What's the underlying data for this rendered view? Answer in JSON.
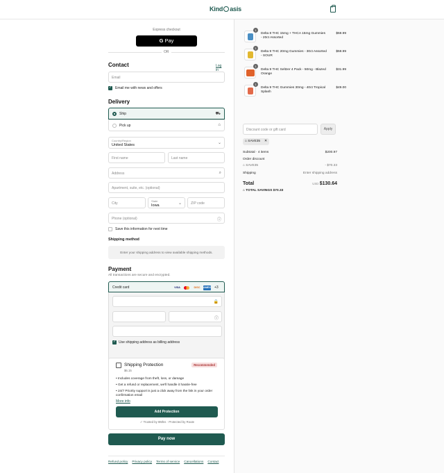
{
  "header": {
    "brand_part1": "Kind",
    "brand_part2": "asis"
  },
  "express": {
    "label": "Express checkout",
    "gpay": "Pay",
    "or": "OR"
  },
  "contact": {
    "title": "Contact",
    "login": "Log in",
    "email_placeholder": "Email",
    "newsletter_label": "Email me with news and offers",
    "newsletter_checked": true
  },
  "delivery": {
    "title": "Delivery",
    "options": [
      {
        "label": "Ship",
        "selected": true
      },
      {
        "label": "Pick up",
        "selected": false
      }
    ],
    "country_label": "Country/Region",
    "country_value": "United States",
    "first_name": "First name",
    "last_name": "Last name",
    "address": "Address",
    "apartment": "Apartment, suite, etc. (optional)",
    "city": "City",
    "state_label": "State",
    "state_value": "Iowa",
    "zip": "ZIP code",
    "phone": "Phone (optional)",
    "save_info": "Save this information for next time"
  },
  "shipping_method": {
    "title": "Shipping method",
    "note": "Enter your shipping address to view available shipping methods."
  },
  "payment": {
    "title": "Payment",
    "subtitle": "All transactions are secure and encrypted.",
    "method": "Credit card",
    "cards": [
      "VISA",
      "MC",
      "DISC",
      "AMEX"
    ],
    "more": "+3",
    "billing_label": "Use shipping address as billing address"
  },
  "protection": {
    "title": "Shipping Protection",
    "price": "$6.15",
    "badge": "Recommended",
    "bullets": [
      "Includes coverage from theft, loss, or damage",
      "Get a refund or replacement, we'll handle it hassle-free",
      "24/7 Priority support is just a click away from the link in your order confirmation email"
    ],
    "more_info": "More info",
    "button": "Add Protection",
    "trusted": "Trusted by 8Mlns · Protected by Route"
  },
  "pay_now": "Pay now",
  "footer": [
    "Refund policy",
    "Privacy policy",
    "Terms of service",
    "Cancellations",
    "Contact"
  ],
  "cart": {
    "items": [
      {
        "qty": "1",
        "name": "Delta 8 THC 15mg + THCA 15mg Gummies - 20ct Assorted",
        "price": "$59.99",
        "color": "#4a8fc4"
      },
      {
        "qty": "1",
        "name": "Delta 9 THC 20mg Gummies - 30ct Assorted - SOUR",
        "price": "$59.99",
        "color": "#e2b830"
      },
      {
        "qty": "1",
        "name": "Delta 9 THC Seltzer 4 Pack - 50mg - Blazed Orange",
        "price": "$31.99",
        "color": "#e0622b"
      },
      {
        "qty": "1",
        "name": "Delta 9 THC Gummies 30mg - 40ct Tropical Splash",
        "price": "$49.00",
        "color": "#e26a4a"
      }
    ],
    "discount_placeholder": "Discount code or gift card",
    "apply": "Apply",
    "code": "SAVE35",
    "subtotal_label": "Subtotal · 4 items",
    "subtotal_value": "$200.97",
    "order_discount_label": "Order discount",
    "discount_code": "SAVE35",
    "discount_value": "- $70.33",
    "shipping_label": "Shipping",
    "shipping_value": "Enter shipping address",
    "total_label": "Total",
    "currency": "USD",
    "total_value": "$130.64",
    "savings_label": "TOTAL SAVINGS",
    "savings_value": "$70.33"
  }
}
